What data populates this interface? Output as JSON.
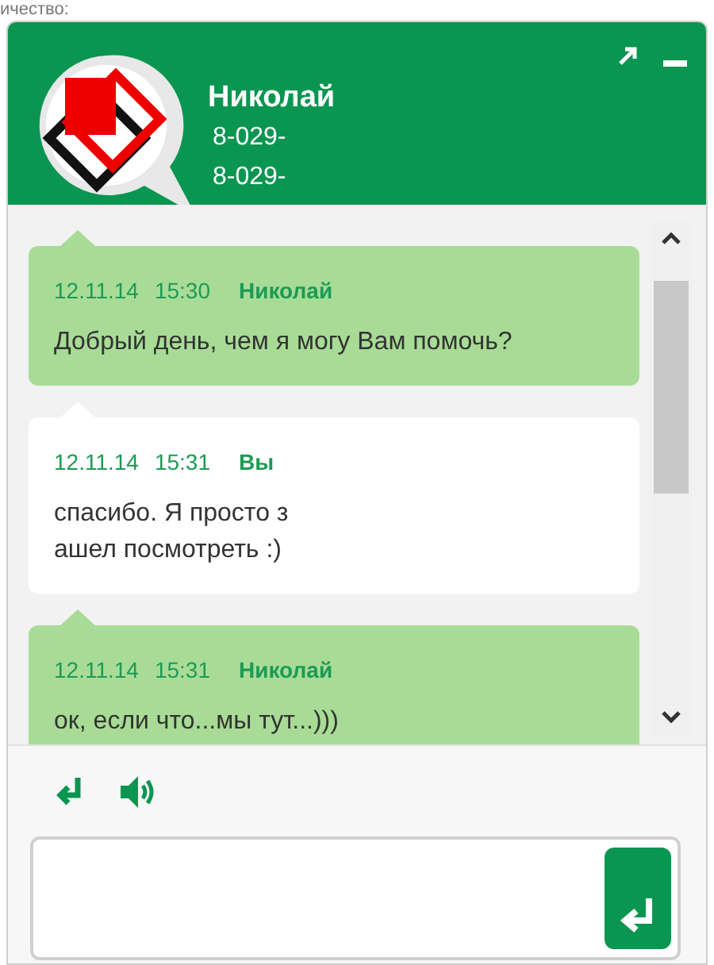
{
  "background_page": {
    "label": "ичество:"
  },
  "header": {
    "name": "Николай",
    "phones": [
      "8-029-",
      "8-029-"
    ]
  },
  "messages": [
    {
      "kind": "agent",
      "date": "12.11.14",
      "time": "15:30",
      "author": "Николай",
      "text": "Добрый день, чем я могу Вам помочь?"
    },
    {
      "kind": "user",
      "date": "12.11.14",
      "time": "15:31",
      "author": "Вы",
      "text": "спасибо. Я просто з\nашел посмотреть :)"
    },
    {
      "kind": "agent",
      "date": "12.11.14",
      "time": "15:31",
      "author": "Николай",
      "text": "ок, если что...мы тут...)))"
    }
  ]
}
